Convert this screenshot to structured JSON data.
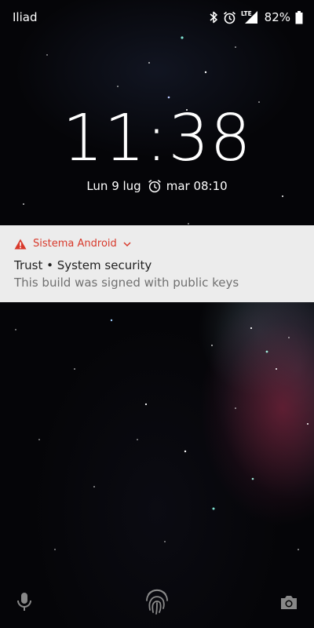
{
  "status_bar": {
    "carrier": "Iliad",
    "network_type": "LTE",
    "battery_percent": "82%",
    "icons": [
      "bluetooth-icon",
      "alarm-icon",
      "signal-icon",
      "battery-icon"
    ]
  },
  "lockscreen": {
    "time": "11:38",
    "date": "Lun 9 lug",
    "next_alarm": "mar 08:10"
  },
  "notification": {
    "app_name": "Sistema Android",
    "title": "Trust • System security",
    "text": "This build was signed with public keys",
    "accent_color": "#d8392b"
  },
  "bottom_bar": {
    "icons": [
      "microphone-icon",
      "fingerprint-icon",
      "camera-icon"
    ]
  }
}
